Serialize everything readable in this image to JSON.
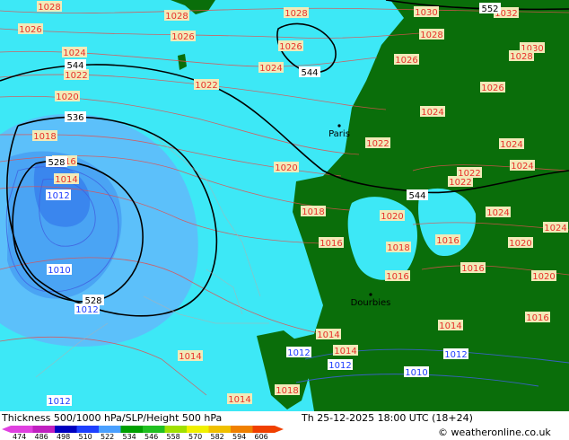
{
  "footer": {
    "title": "Thickness 500/1000 hPa/SLP/Height 500 hPa",
    "datetime": "Th 25-12-2025 18:00 UTC (18+24)",
    "copyright": "© weatheronline.co.uk"
  },
  "legend": {
    "values": [
      "474",
      "486",
      "498",
      "510",
      "522",
      "534",
      "546",
      "558",
      "570",
      "582",
      "594",
      "606"
    ],
    "colors": [
      "#e040e0",
      "#c020c0",
      "#0000c0",
      "#1e40ff",
      "#4aa0ff",
      "#00a000",
      "#20c020",
      "#a0e000",
      "#f0f000",
      "#f0c000",
      "#f08000",
      "#f04000"
    ]
  },
  "colors": {
    "sea": "#3de8f6",
    "land": "#0a6e0a",
    "cold_light": "#5cc0fa",
    "cold_mid": "#4aa4f4",
    "cold_deep": "#3a86ee"
  },
  "places": [
    {
      "name": "Paris"
    },
    {
      "name": "Dourbies"
    }
  ],
  "isobars": [
    {
      "text": "1028",
      "style": "red"
    },
    {
      "text": "1028",
      "style": "red"
    },
    {
      "text": "1028",
      "style": "red"
    },
    {
      "text": "1030",
      "style": "red"
    },
    {
      "text": "1032",
      "style": "red"
    },
    {
      "text": "1026",
      "style": "red"
    },
    {
      "text": "1026",
      "style": "red"
    },
    {
      "text": "1026",
      "style": "red"
    },
    {
      "text": "1028",
      "style": "red"
    },
    {
      "text": "1030",
      "style": "red"
    },
    {
      "text": "1028",
      "style": "red"
    },
    {
      "text": "1024",
      "style": "red"
    },
    {
      "text": "1024",
      "style": "red"
    },
    {
      "text": "1026",
      "style": "red"
    },
    {
      "text": "1022",
      "style": "red"
    },
    {
      "text": "1022",
      "style": "red"
    },
    {
      "text": "1026",
      "style": "red"
    },
    {
      "text": "1020",
      "style": "red"
    },
    {
      "text": "1024",
      "style": "red"
    },
    {
      "text": "1018",
      "style": "red"
    },
    {
      "text": "1022",
      "style": "red"
    },
    {
      "text": "1024",
      "style": "red"
    },
    {
      "text": "1016",
      "style": "red"
    },
    {
      "text": "1020",
      "style": "red"
    },
    {
      "text": "1022",
      "style": "red"
    },
    {
      "text": "1014",
      "style": "red"
    },
    {
      "text": "1012",
      "style": "blue"
    },
    {
      "text": "1018",
      "style": "red"
    },
    {
      "text": "1020",
      "style": "red"
    },
    {
      "text": "1024",
      "style": "red"
    },
    {
      "text": "1016",
      "style": "red"
    },
    {
      "text": "1018",
      "style": "red"
    },
    {
      "text": "1016",
      "style": "red"
    },
    {
      "text": "1016",
      "style": "red"
    },
    {
      "text": "1010",
      "style": "blue"
    },
    {
      "text": "1012",
      "style": "blue"
    },
    {
      "text": "1016",
      "style": "red"
    },
    {
      "text": "1016",
      "style": "red"
    },
    {
      "text": "1014",
      "style": "red"
    },
    {
      "text": "1014",
      "style": "red"
    },
    {
      "text": "1012",
      "style": "blue"
    },
    {
      "text": "1012",
      "style": "blue"
    },
    {
      "text": "1012",
      "style": "blue"
    },
    {
      "text": "1010",
      "style": "blue"
    },
    {
      "text": "1014",
      "style": "red"
    },
    {
      "text": "1014",
      "style": "red"
    },
    {
      "text": "1012",
      "style": "blue"
    },
    {
      "text": "1014",
      "style": "red"
    },
    {
      "text": "1018",
      "style": "red"
    },
    {
      "text": "1022",
      "style": "red"
    },
    {
      "text": "1024",
      "style": "red"
    },
    {
      "text": "1020",
      "style": "red"
    },
    {
      "text": "1020",
      "style": "red"
    },
    {
      "text": "1024",
      "style": "red"
    }
  ],
  "heights": [
    {
      "text": "552"
    },
    {
      "text": "544"
    },
    {
      "text": "544"
    },
    {
      "text": "536"
    },
    {
      "text": "528"
    },
    {
      "text": "528"
    },
    {
      "text": "544"
    }
  ]
}
